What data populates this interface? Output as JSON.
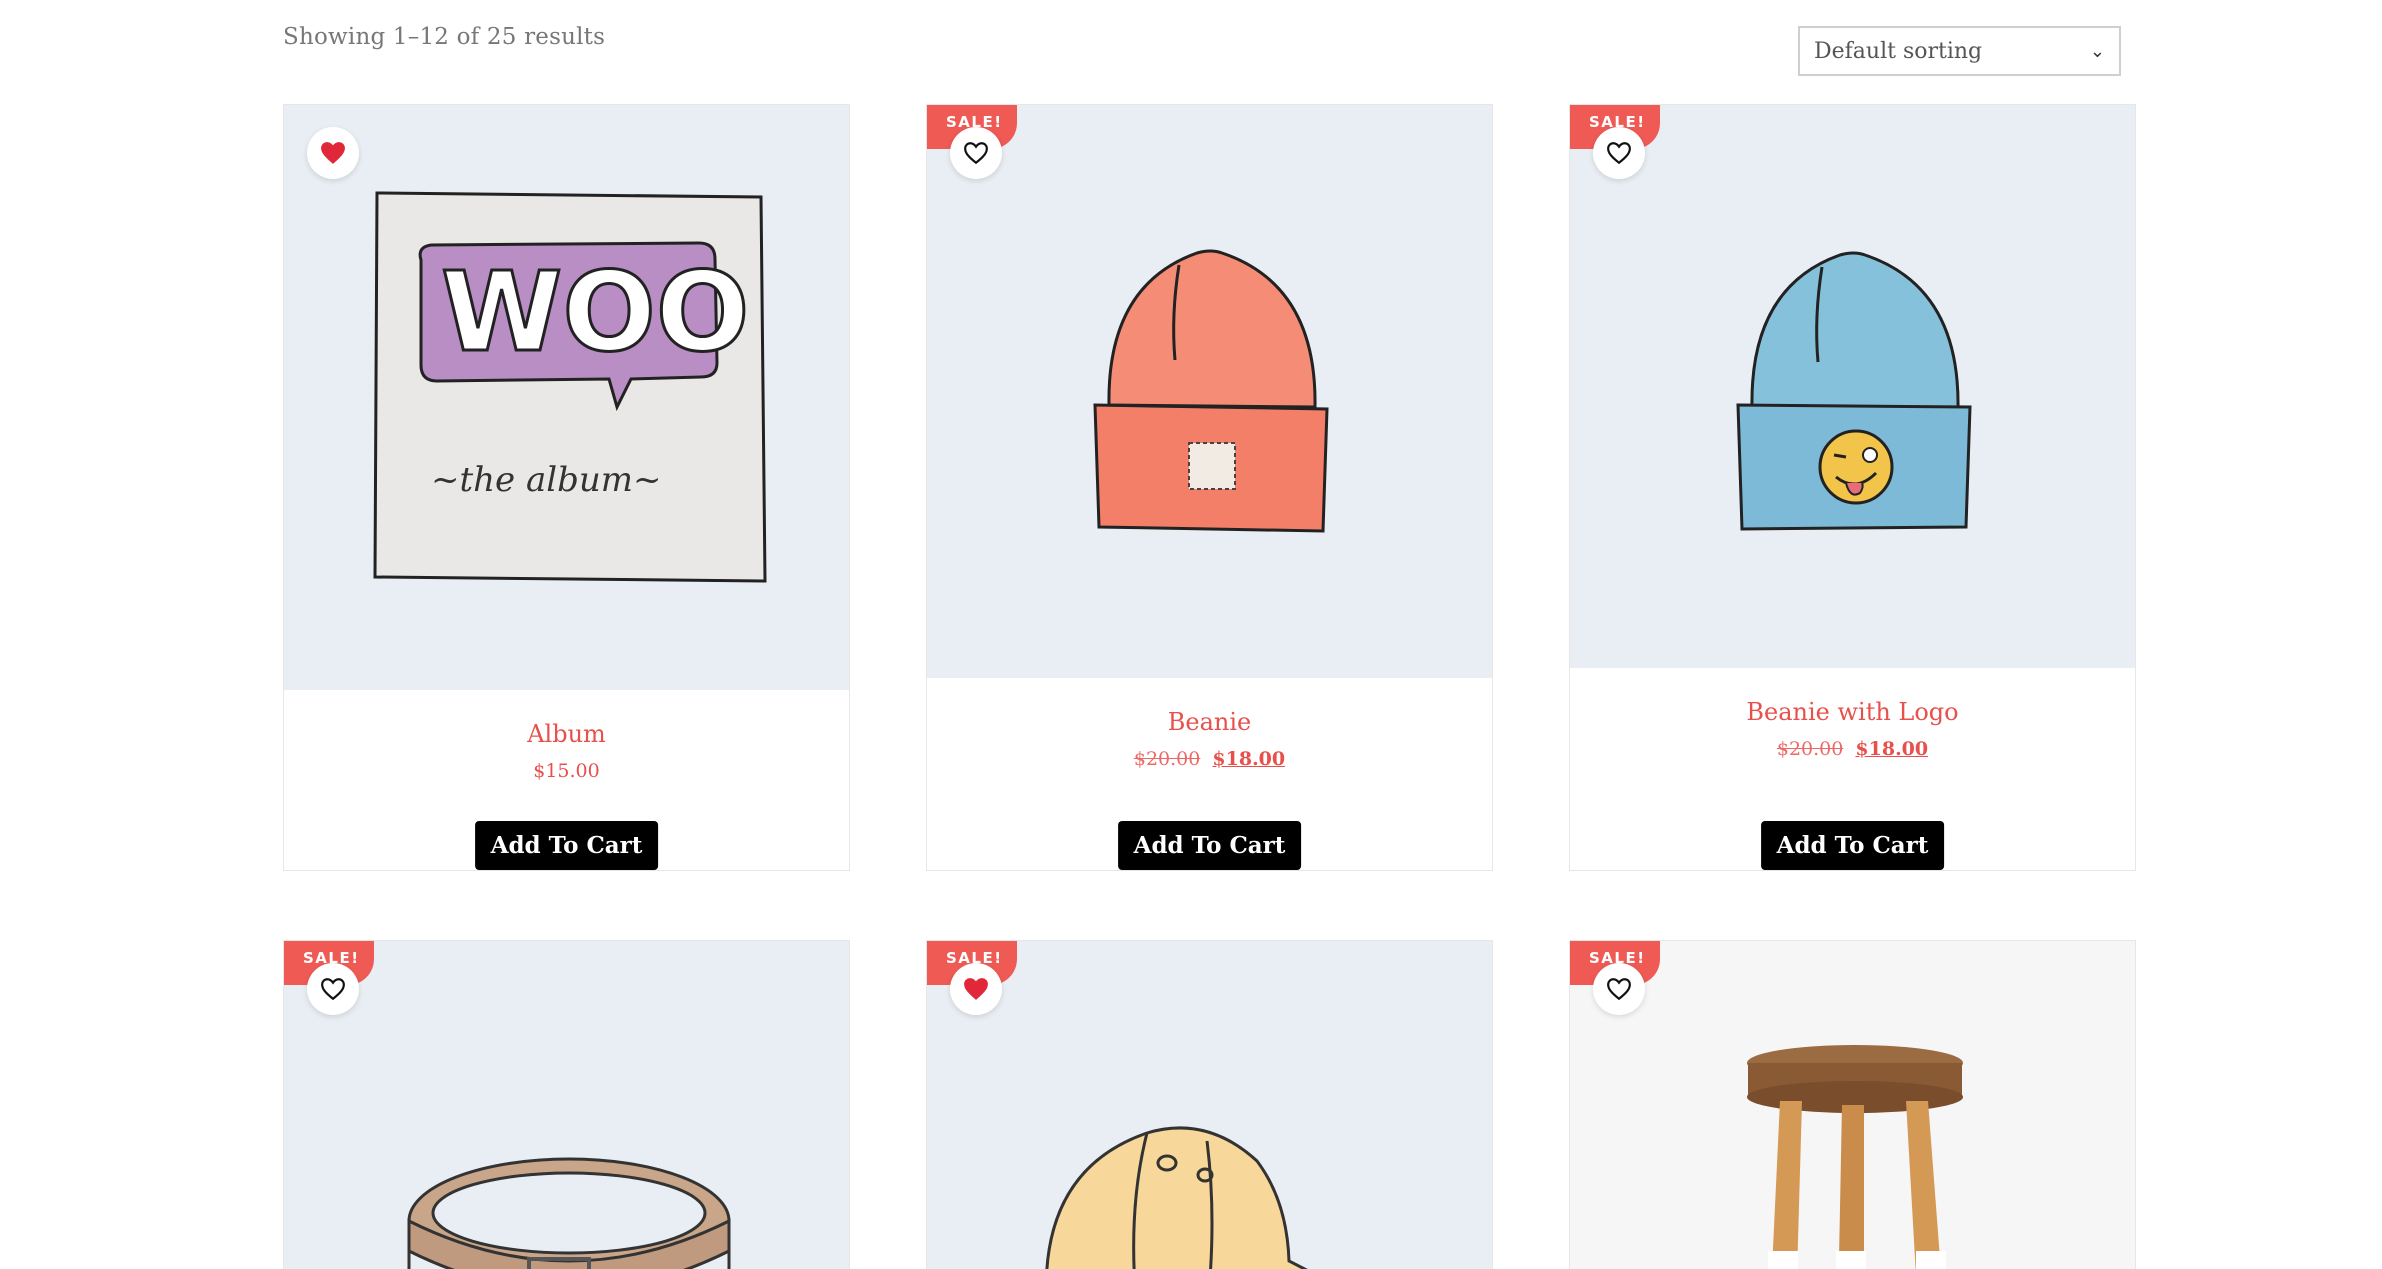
{
  "toolbar": {
    "result_count": "Showing 1–12 of 25 results",
    "sort_selected": "Default sorting"
  },
  "products": [
    {
      "title": "Album",
      "price": "$15.00",
      "sale": false,
      "wishlisted": true,
      "button": "Add To Cart"
    },
    {
      "title": "Beanie",
      "old_price": "$20.00",
      "price": "$18.00",
      "sale": true,
      "sale_badge": "SALE!",
      "wishlisted": false,
      "button": "Add To Cart"
    },
    {
      "title": "Beanie with Logo",
      "old_price": "$20.00",
      "price": "$18.00",
      "sale": true,
      "sale_badge": "SALE!",
      "wishlisted": false,
      "button": "Add To Cart"
    },
    {
      "title": "",
      "sale": true,
      "sale_badge": "SALE!",
      "wishlisted": false
    },
    {
      "title": "",
      "sale": true,
      "sale_badge": "SALE!",
      "wishlisted": true
    },
    {
      "title": "",
      "sale": true,
      "sale_badge": "SALE!",
      "wishlisted": false
    }
  ],
  "colors": {
    "accent": "#e8504b",
    "sale_badge": "#ef5a55",
    "heart_filled": "#e0283a",
    "thumb_bg": "#e8eef3",
    "button_bg": "#000000"
  },
  "icons": {
    "wishlist_filled": "heart-filled-icon",
    "wishlist_empty": "heart-outline-icon",
    "sort": "chevron-down-icon"
  }
}
